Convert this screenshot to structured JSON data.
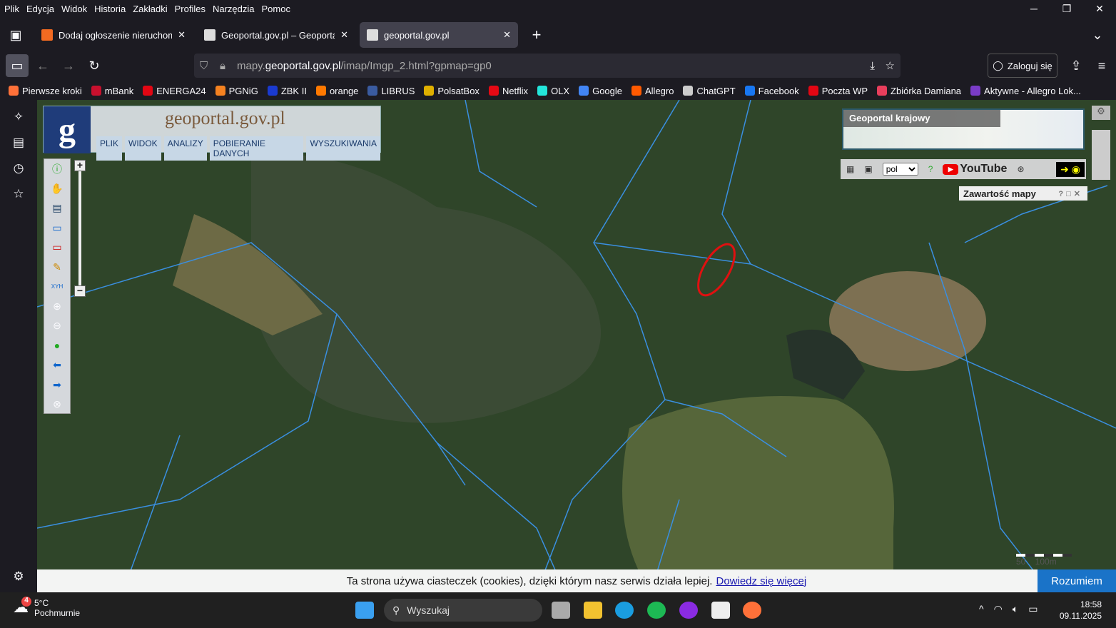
{
  "menu": [
    "Plik",
    "Edycja",
    "Widok",
    "Historia",
    "Zakładki",
    "Profiles",
    "Narzędzia",
    "Pomoc"
  ],
  "tabs": [
    {
      "title": "Dodaj ogłoszenie nieruchomości"
    },
    {
      "title": "Geoportal.gov.pl – Geoportal Inf"
    },
    {
      "title": "geoportal.gov.pl",
      "active": true
    }
  ],
  "url": {
    "prefix": "mapy.",
    "domain": "geoportal.gov.pl",
    "path": "/imap/Imgp_2.html?gpmap=gp0"
  },
  "login": "Zaloguj się",
  "bookmarks": [
    {
      "label": "Pierwsze kroki",
      "color": "#ff7139"
    },
    {
      "label": "mBank",
      "color": "#c8102e"
    },
    {
      "label": "ENERGA24",
      "color": "#e30613"
    },
    {
      "label": "PGNiG",
      "color": "#f58220"
    },
    {
      "label": "ZBK II",
      "color": "#1a3ad0"
    },
    {
      "label": "orange",
      "color": "#ff7900"
    },
    {
      "label": "LIBRUS",
      "color": "#3a5ba0"
    },
    {
      "label": "PolsatBox",
      "color": "#e0b000"
    },
    {
      "label": "Netflix",
      "color": "#e50914"
    },
    {
      "label": "OLX",
      "color": "#23e5db"
    },
    {
      "label": "Google",
      "color": "#4285f4"
    },
    {
      "label": "Allegro",
      "color": "#ff5a00"
    },
    {
      "label": "ChatGPT",
      "color": "#cccccc"
    },
    {
      "label": "Facebook",
      "color": "#1877f2"
    },
    {
      "label": "Poczta WP",
      "color": "#e30613"
    },
    {
      "label": "Zbiórka Damiana",
      "color": "#e83e5c"
    },
    {
      "label": "Aktywne - Allegro Lok...",
      "color": "#7a3cc8"
    }
  ],
  "geoportal": {
    "logo": "geoportal.gov.pl",
    "menu": [
      "PLIK",
      "WIDOK",
      "ANALIZY",
      "POBIERANIE DANYCH",
      "WYSZUKIWANIA"
    ],
    "overview_title": "Geoportal krajowy",
    "language": "pol",
    "youtube": "YouTube",
    "content_panel": "Zawartość mapy",
    "scale": "50    100m"
  },
  "cookie": {
    "text": "Ta strona używa ciasteczek (cookies), dzięki którym nasz serwis działa lepiej.",
    "link": "Dowiedz się więcej",
    "button": "Rozumiem"
  },
  "taskbar": {
    "temp": "5°C",
    "weather": "Pochmurnie",
    "badge": "4",
    "search": "Wyszukaj",
    "time": "18:58",
    "date": "09.11.2025"
  },
  "colors": {
    "parcel_lines": "#3a8fe0",
    "marker": "#e01010"
  }
}
